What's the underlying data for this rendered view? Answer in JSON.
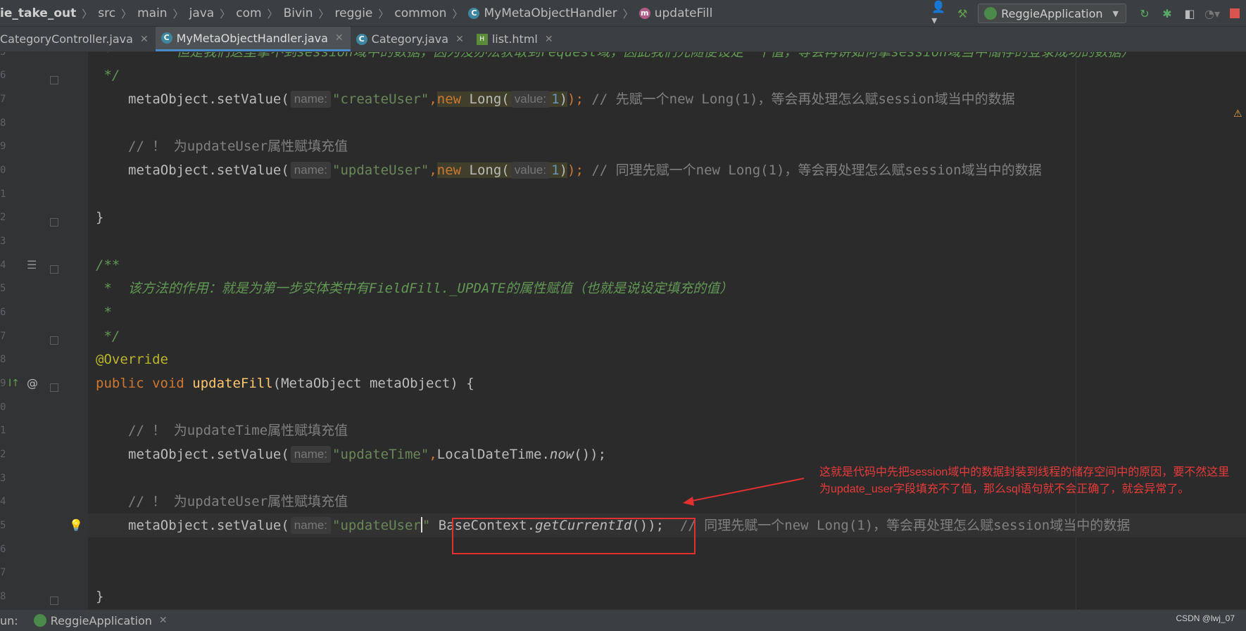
{
  "breadcrumb": [
    "ie_take_out",
    "src",
    "main",
    "java",
    "com",
    "Bivin",
    "reggie",
    "common",
    "MyMetaObjectHandler",
    "updateFill"
  ],
  "run_config": "ReggieApplication",
  "tabs": [
    {
      "label": "CategoryController.java",
      "active": false
    },
    {
      "label": "MyMetaObjectHandler.java",
      "active": true
    },
    {
      "label": "Category.java",
      "active": false
    },
    {
      "label": "list.html",
      "active": false
    }
  ],
  "line_numbers": [
    "5",
    "6",
    "7",
    "8",
    "9",
    "0",
    "1",
    "2",
    "3",
    "4",
    "5",
    "6",
    "7",
    "8",
    "9",
    "0",
    "1",
    "2",
    "3",
    "4",
    "5",
    "6",
    "7",
    "8"
  ],
  "code": {
    "l1_star": " *",
    "l1_comment": "        但是我们这里拿不到session域中的数据，因为没办法获取到request域，因此我们先随便设定一个值，等会再讲如何拿session域当中储存的登录成功的数据）",
    "l2": " */",
    "l3_obj": "metaObject.setValue(",
    "hint_name": "name:",
    "hint_value": "value:",
    "str_createUser": "\"createUser\"",
    "comma": ",",
    "kw_new": "new",
    "long_open": " Long(",
    "num_1": "1",
    "close_semi": ");",
    "l3_comment": " // 先赋一个new Long(1)，等会再处理怎么赋session域当中的数据",
    "l5_comment": "// ！ 为updateUser属性赋填充值",
    "str_updateUser": "\"updateUser\"",
    "l6_comment": " // 同理先赋一个new Long(1)，等会再处理怎么赋session域当中的数据",
    "brace_close": "}",
    "doc_open": "/**",
    "doc_line": " *  该方法的作用：就是为第一步实体类中有FieldFill._UPDATE的属性赋值（也就是说设定填充的值）",
    "doc_star": " *",
    "doc_close": " */",
    "override": "@Override",
    "kw_public": "public",
    "kw_void": " void ",
    "fn_updateFill": "updateFill",
    "params": "(MetaObject metaObject) {",
    "l18_comment": "// ！ 为updateTime属性赋填充值",
    "str_updateTime": "\"updateTime\"",
    "ldt": "LocalDateTime.",
    "now": "now",
    "parens_close": "());",
    "l21_comment": "// ！ 为updateUser属性赋填充值",
    "str_updateUser_partial": "\"updateUser",
    "quote": "\"",
    "base_ctx": "BaseContext.",
    "get_id": "getCurrentId",
    "l22_comment": "  // 同理先赋一个new Long(1)，等会再处理怎么赋session域当中的数据"
  },
  "annotation": "这就是代码中先把session域中的数据封装到线程的储存空间中的原因，要不然这里为update_user字段填充不了值，那么sql语句就不会正确了，就会异常了。",
  "bottom": {
    "label": "un:",
    "run_tab": "ReggieApplication"
  },
  "watermark": "CSDN @lwj_07",
  "colors": {
    "annotation": "#e83a3a",
    "keyword": "#cc7832",
    "string": "#6a8759",
    "comment": "#808080"
  }
}
